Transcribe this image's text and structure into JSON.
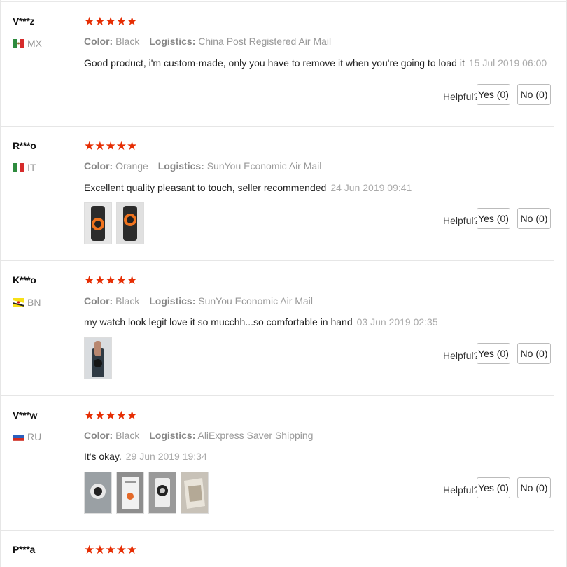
{
  "labels": {
    "color": "Color:",
    "logistics": "Logistics:",
    "helpful": "Helpful?",
    "stars": "★★★★★"
  },
  "reviews": [
    {
      "user": "V***z",
      "country": "MX",
      "color": "Black",
      "logistics": "China Post Registered Air Mail",
      "text": "Good product, i'm custom-made, only you have to remove it when you're going to load it",
      "date": "15 Jul 2019 06:00",
      "yes": "Yes (0)",
      "no": "No (0)",
      "image_count": 0
    },
    {
      "user": "R***o",
      "country": "IT",
      "color": "Orange",
      "logistics": "SunYou Economic Air Mail",
      "text": "Excellent quality pleasant to touch, seller recommended",
      "date": "24 Jun 2019 09:41",
      "yes": "Yes (0)",
      "no": "No (0)",
      "image_count": 2
    },
    {
      "user": "K***o",
      "country": "BN",
      "color": "Black",
      "logistics": "SunYou Economic Air Mail",
      "text": "my watch look legit love it so mucchh...so comfortable in hand",
      "date": "03 Jun 2019 02:35",
      "yes": "Yes (0)",
      "no": "No (0)",
      "image_count": 1
    },
    {
      "user": "V***w",
      "country": "RU",
      "color": "Black",
      "logistics": "AliExpress Saver Shipping",
      "text": "It's okay.",
      "date": "29 Jun 2019 19:34",
      "yes": "Yes (0)",
      "no": "No (0)",
      "image_count": 4
    },
    {
      "user": "P***a"
    }
  ]
}
